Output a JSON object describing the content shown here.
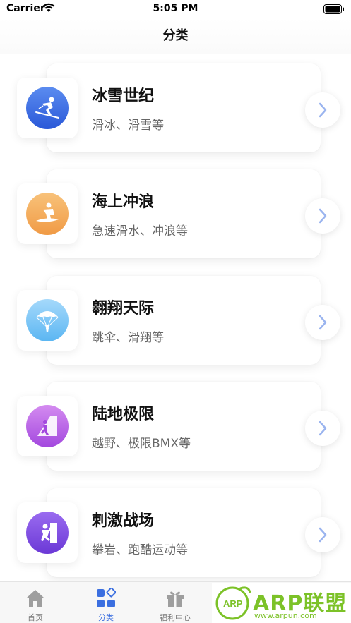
{
  "status_bar": {
    "carrier": "Carrier",
    "time": "5:05 PM"
  },
  "nav": {
    "title": "分类"
  },
  "categories": [
    {
      "title": "冰雪世纪",
      "subtitle": "滑冰、滑雪等",
      "icon": "skier-icon",
      "color_top": "#5b8cf0",
      "color_bottom": "#2a58d8"
    },
    {
      "title": "海上冲浪",
      "subtitle": "急速滑水、冲浪等",
      "icon": "surfer-icon",
      "color_top": "#f8c27a",
      "color_bottom": "#f09a45"
    },
    {
      "title": "翱翔天际",
      "subtitle": "跳伞、滑翔等",
      "icon": "parachute-icon",
      "color_top": "#a5d9fb",
      "color_bottom": "#5bb6f2"
    },
    {
      "title": "陆地极限",
      "subtitle": "越野、极限BMX等",
      "icon": "climber-icon",
      "color_top": "#d48bf0",
      "color_bottom": "#a348de"
    },
    {
      "title": "刺激战场",
      "subtitle": "攀岩、跑酷运动等",
      "icon": "rock-climb-icon",
      "color_top": "#9a6cf0",
      "color_bottom": "#6b38d6"
    }
  ],
  "tab_bar": {
    "tabs": [
      {
        "label": "首页",
        "icon": "home-icon",
        "active": false
      },
      {
        "label": "分类",
        "icon": "category-icon",
        "active": true
      },
      {
        "label": "福利中心",
        "icon": "gift-icon",
        "active": false
      }
    ]
  },
  "watermark": {
    "brand": "ARP联盟",
    "url": "www.arpun.com",
    "badge": "ARP",
    "color": "#7cc228"
  },
  "colors": {
    "accent": "#3b6fe0",
    "chevron": "#9ab4ef"
  }
}
